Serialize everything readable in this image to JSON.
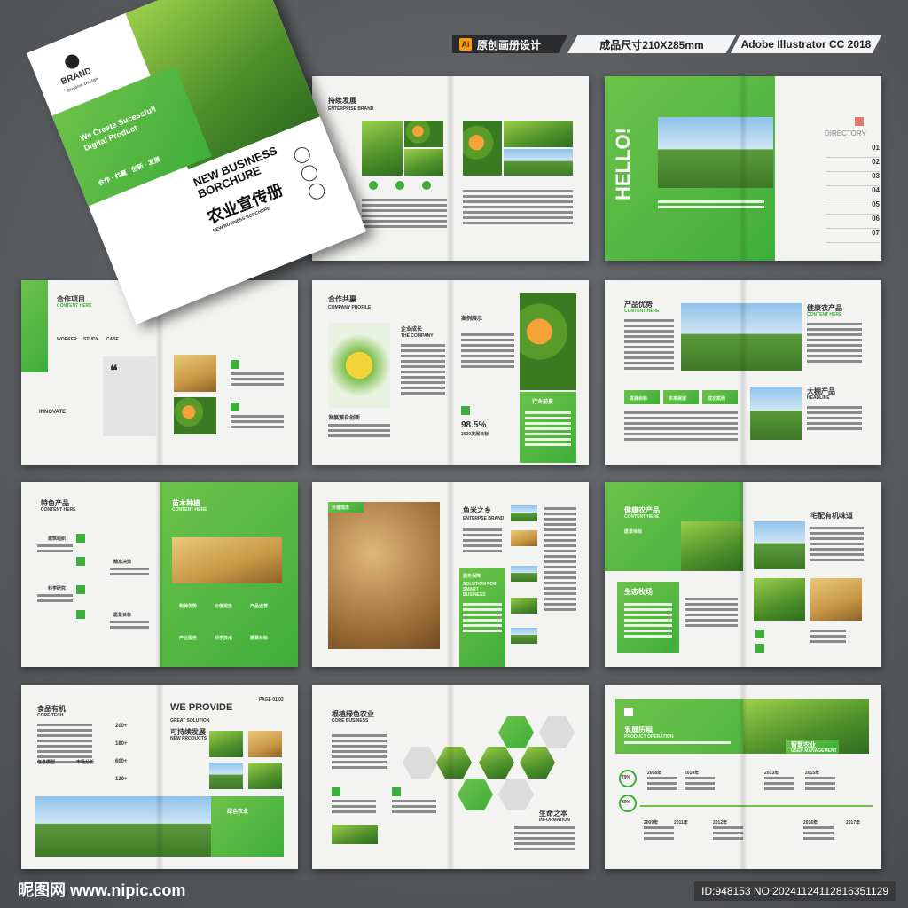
{
  "header": {
    "tag1": "原创画册设计",
    "tag2": "成品尺寸210X285mm",
    "tag3": "Adobe Illustrator CC 2018"
  },
  "cover": {
    "brand": "BRAND",
    "brand_sub": "Creative Design",
    "slogan": "We Create Sucessfull Digital Product",
    "keywords": "合作 · 共赢 · 创新 · 发展",
    "title_en": "NEW BUSINESS BORCHURE",
    "title_cn": "农业宣传册",
    "title_en_small": "NEW BUSINESS BORCHURE"
  },
  "pages": {
    "p1_title": "持续发展",
    "p1_sub": "ENTERPRISE BRAND",
    "p2_hello": "HELLO!",
    "p2_directory": "DIRECTORY",
    "p2_nums": [
      "01",
      "02",
      "03",
      "04",
      "05",
      "06",
      "07"
    ],
    "p3_title": "合作项目",
    "p3_sub": "CONTENT HERE",
    "p3_innovate": "INNOVATE",
    "p3_tabs": [
      "WORKER",
      "STUDY",
      "CASE"
    ],
    "p4_title": "合作共赢",
    "p4_sub": "COMPANY PROFILE",
    "p4_company": "企业成长",
    "p4_company_en": "THE COMPANY",
    "p4_case": "案例展示",
    "p4_stat": "98.5%",
    "p4_stat_sub": "2030发展目标",
    "p4_prospect": "行业前景",
    "p4_caption": "发展源自创新",
    "p5_title": "产品优势",
    "p5_sub": "CONTENT HERE",
    "p5_title2": "健康农产品",
    "p5_sub2": "CONTENT HERE",
    "p5_title3": "大棚产品",
    "p5_sub3": "HEADLINE",
    "p5_icons": [
      "发展目标",
      "未来展望",
      "成功案例"
    ],
    "p6_title": "特色产品",
    "p6_sub": "CONTENT HERE",
    "p6_items": [
      "建筑组织",
      "精准决策",
      "科学研究",
      "愿景目标"
    ],
    "p6_title2": "苗木种植",
    "p6_sub2": "CONTENT HERE",
    "p6_icons": [
      "物种优势",
      "价值观念",
      "产品运营",
      "产业服务",
      "科学技术",
      "愿景目标"
    ],
    "p7_label": "价值观念",
    "p7_title": "鱼米之乡",
    "p7_sub": "ENTERPSE BRAND",
    "p7_service": "服务保障",
    "p7_service_sub": "SOLUTION FOR SMART BUSINESS",
    "p8_title": "健康农产品",
    "p8_sub": "CONTENT HERE",
    "p8_vision": "愿景目标",
    "p8_title2": "宅配有机味道",
    "p8_ranch": "生态牧场",
    "p9_title": "食品有机",
    "p9_sub": "CORE TECH",
    "p9_items": [
      "信息模型",
      "市场分析"
    ],
    "p9_nums": [
      "200+",
      "180+",
      "600+",
      "120+"
    ],
    "p9_we": "WE PROVIDE",
    "p9_we_sub": "GREAT SOLUTION",
    "p9_title2": "可持续发展",
    "p9_title2_sub": "NEW PRODUCTS",
    "p9_page": "PAGE 01/02",
    "p9_green": "绿色农业",
    "p10_title": "根植绿色农业",
    "p10_sub": "CORE BUSINESS",
    "p10_title2": "生命之本",
    "p10_sub2": "INFORMATION",
    "p11_title": "发展历程",
    "p11_sub": "PRODUCT OPERATION",
    "p11_smart": "智慧农业",
    "p11_smart_sub": "USER MANAGEMENT",
    "p11_pcts": [
      "79%",
      "80%"
    ],
    "p11_years_top": [
      "2008年",
      "2010年",
      "2013年",
      "2015年"
    ],
    "p11_years_bottom": [
      "2009年",
      "2011年",
      "2012年",
      "2016年",
      "2017年"
    ]
  },
  "footer": {
    "site_logo": "昵图网 www.nipic.com",
    "id_text": "ID:948153 NO:20241124112816351129"
  },
  "colors": {
    "accent": "#3fae3a",
    "accent_light": "#6cc24a",
    "background": "#5b5e61"
  }
}
